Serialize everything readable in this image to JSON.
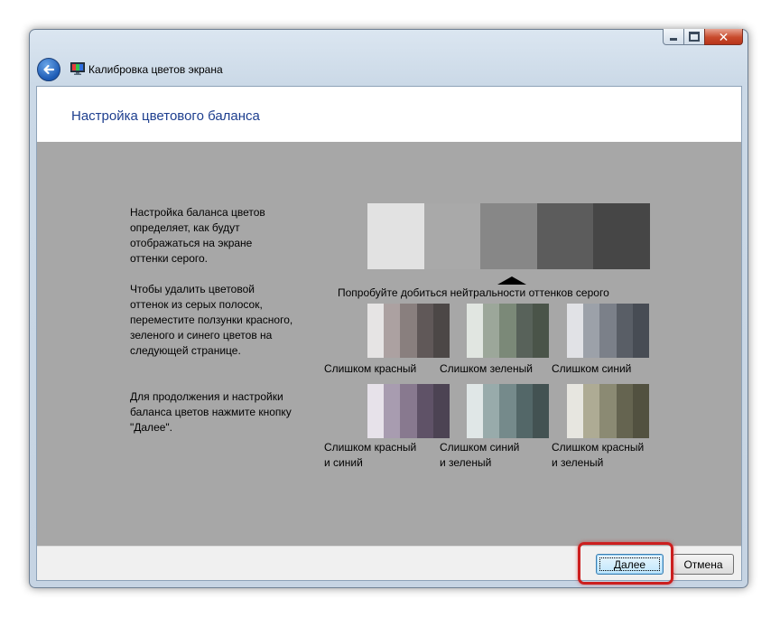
{
  "window": {
    "title": "Калибровка цветов экрана",
    "controls": {
      "minimize": "minimize",
      "maximize": "maximize",
      "close": "close"
    }
  },
  "header": {
    "title": "Настройка цветового баланса"
  },
  "instructions": {
    "p1": "Настройка баланса цветов\nопределяет, как будут\nотображаться на экране\nоттенки серого.",
    "p2": "Чтобы удалить цветовой\nоттенок из серых полосок,\nпереместите ползунки красного,\nзеленого и синего цветов на\nследующей странице.",
    "p3": "Для продолжения и настройки\nбаланса цветов нажмите кнопку\n\"Далее\"."
  },
  "gray_reference": {
    "hint": "Попробуйте добиться нейтральности оттенков серого",
    "swatches": [
      "#e2e2e2",
      "#a9a9a9",
      "#878787",
      "#5c5c5c",
      "#464646"
    ]
  },
  "examples": [
    {
      "caption": "Слишком красный",
      "colors": [
        "#e6e4e4",
        "#aca1a1",
        "#897f7e",
        "#605858",
        "#4c4746"
      ]
    },
    {
      "caption": "Слишком зеленый",
      "colors": [
        "#e1e6e1",
        "#9ca79a",
        "#7b8978",
        "#58625a",
        "#4a5449"
      ]
    },
    {
      "caption": "Слишком синий",
      "colors": [
        "#e1e2e6",
        "#9ca1a9",
        "#7b8089",
        "#595e66",
        "#474c54"
      ]
    },
    {
      "caption": "Слишком красный\nи синий",
      "colors": [
        "#e7e2ea",
        "#a89cb0",
        "#88798f",
        "#5f5267",
        "#4c4353"
      ]
    },
    {
      "caption": "Слишком синий\nи зеленый",
      "colors": [
        "#e0e7e7",
        "#98abab",
        "#758a8b",
        "#536768",
        "#435252"
      ]
    },
    {
      "caption": "Слишком красный\nи зеленый",
      "colors": [
        "#e7e6e0",
        "#aeab94",
        "#8b8a73",
        "#656450",
        "#525140"
      ]
    }
  ],
  "footer": {
    "next_label": "Далее",
    "cancel_label": "Отмена"
  },
  "colors": {
    "accent_highlight": "#cc1f1f",
    "title_blue": "#1e3f8f",
    "gray_bg": "#a7a7a7"
  }
}
